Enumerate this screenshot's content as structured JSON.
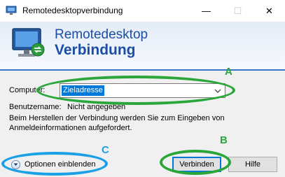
{
  "titlebar": {
    "title": "Remotedesktopverbindung",
    "minimize_glyph": "—",
    "maximize_glyph": "☐",
    "close_glyph": "✕",
    "icon": "remote-desktop-icon"
  },
  "banner": {
    "line1": "Remotedesktop",
    "line2": "Verbindung",
    "icon": "remote-desktop-monitor-icon"
  },
  "form": {
    "computer_label": "Computer:",
    "computer_value": "Zieladresse",
    "username_label": "Benutzername:",
    "username_value": "Nicht angegeben",
    "info_line1": "Beim Herstellen der Verbindung werden Sie zum Eingeben von",
    "info_line2": "Anmeldeinformationen aufgefordert."
  },
  "footer": {
    "options_label": "Optionen einblenden",
    "connect_label": "Verbinden",
    "help_label": "Hilfe"
  },
  "annotations": {
    "a": "A",
    "b": "B",
    "c": "C",
    "green": "#2aa63a",
    "blue": "#1aa0e6"
  },
  "colors": {
    "brand_text": "#1b4ea4",
    "selection": "#0078d7",
    "button_face": "#e1e1e1"
  }
}
